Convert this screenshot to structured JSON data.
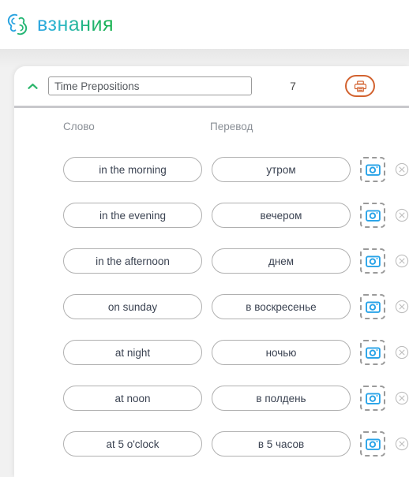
{
  "brand": {
    "name": "взнания",
    "logo_icon": "interlocking-leaf-brain-icon",
    "gradient_start": "#29a3e0",
    "gradient_end": "#14b14b"
  },
  "set_header": {
    "collapse_icon": "chevron-up-icon",
    "collapse_icon_color": "#2ab56b",
    "title_value": "Time Prepositions",
    "title_placeholder": "Time Prepositions",
    "count": "7",
    "print_icon": "printer-icon",
    "print_color": "#d2622f"
  },
  "columns": {
    "word": "Слово",
    "translation": "Перевод"
  },
  "row_icons": {
    "image_icon": "camera-icon",
    "image_icon_color": "#27a3e8",
    "delete_icon": "circle-close-icon",
    "delete_icon_color": "#bdbdbd"
  },
  "rows": [
    {
      "word": "in the morning",
      "translation": "утром"
    },
    {
      "word": "in the evening",
      "translation": "вечером"
    },
    {
      "word": "in the afternoon",
      "translation": "днем"
    },
    {
      "word": "on sunday",
      "translation": "в воскресенье"
    },
    {
      "word": "at night",
      "translation": "ночью"
    },
    {
      "word": "at noon",
      "translation": "в полдень"
    },
    {
      "word": "at 5 o'clock",
      "translation": "в 5 часов"
    }
  ]
}
